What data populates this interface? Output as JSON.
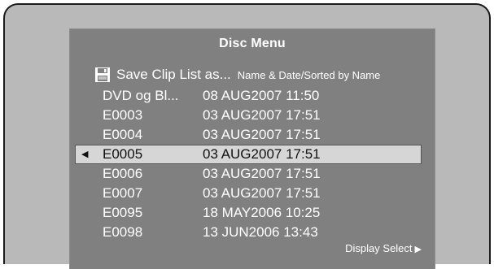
{
  "menu": {
    "title": "Disc Menu"
  },
  "save": {
    "icon": "floppy-disk-icon",
    "label": "Save Clip List as...",
    "sort_info": "Name & Date/Sorted by Name"
  },
  "clips": [
    {
      "name": "DVD og Bl...",
      "date": "08 AUG2007 11:50",
      "selected": false
    },
    {
      "name": "E0003",
      "date": "03 AUG2007 17:51",
      "selected": false
    },
    {
      "name": "E0004",
      "date": "03 AUG2007 17:51",
      "selected": false
    },
    {
      "name": "E0005",
      "date": "03 AUG2007 17:51",
      "selected": true
    },
    {
      "name": "E0006",
      "date": "03 AUG2007 17:51",
      "selected": false
    },
    {
      "name": "E0007",
      "date": "03 AUG2007 17:51",
      "selected": false
    },
    {
      "name": "E0095",
      "date": "18 MAY2006 10:25",
      "selected": false
    },
    {
      "name": "E0098",
      "date": "13 JUN2006 13:43",
      "selected": false
    }
  ],
  "selection_marker": "◀",
  "footer": {
    "display_select_label": "Display Select",
    "display_select_icon": "▶"
  },
  "colors": {
    "screen_background": "#808080",
    "bezel": "#b9b9b9",
    "text": "#ffffff",
    "selection_bar": "#d6d6d6"
  }
}
